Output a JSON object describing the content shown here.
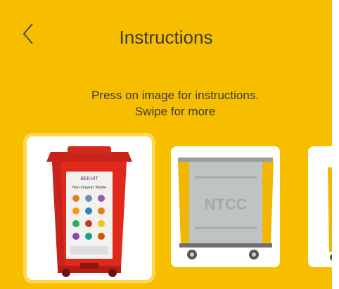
{
  "header": {
    "title": "Instructions",
    "back_icon": "chevron-left-icon"
  },
  "hint": {
    "line1": "Press on image for instructions.",
    "line2": "Swipe for more"
  },
  "colors": {
    "background": "#F7BE00",
    "text": "#3a3a3a",
    "bin_red": "#E0291B",
    "bin_dark_red": "#B81B12",
    "cart_yellow": "#F2B705",
    "cart_gray": "#BFC3C4"
  },
  "carousel": {
    "items": [
      {
        "name": "red-bin",
        "label_line1": "BEKHIT",
        "label_line2": "Non-Organic Waste",
        "selected": true
      },
      {
        "name": "ntcc-cart",
        "label": "NTCC",
        "selected": false
      },
      {
        "name": "third-item",
        "selected": false
      }
    ]
  }
}
